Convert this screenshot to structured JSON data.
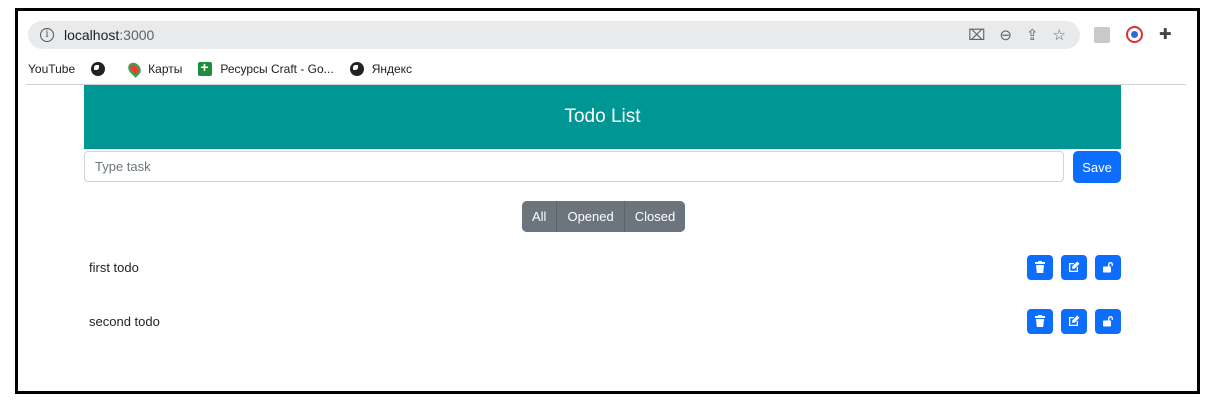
{
  "browser": {
    "url_host": "localhost",
    "url_port": ":3000",
    "bookmarks": [
      {
        "label": "YouTube",
        "icon": "none"
      },
      {
        "label": "",
        "icon": "globe-icon"
      },
      {
        "label": "Карты",
        "icon": "maps-pin-icon"
      },
      {
        "label": "Ресурсы Craft - Go...",
        "icon": "sheets-icon"
      },
      {
        "label": "Яндекс",
        "icon": "globe-icon"
      }
    ],
    "address_icons": [
      "translate-icon",
      "zoom-icon",
      "share-icon",
      "star-icon"
    ],
    "extension_icons": [
      "extension-gray-icon",
      "extension-circle-icon",
      "puzzle-icon"
    ]
  },
  "app": {
    "title": "Todo List",
    "input": {
      "placeholder": "Type task",
      "value": ""
    },
    "save_label": "Save",
    "filters": [
      "All",
      "Opened",
      "Closed"
    ],
    "todos": [
      {
        "text": "first todo",
        "status": "opened"
      },
      {
        "text": "second todo",
        "status": "opened"
      }
    ],
    "action_icons": [
      "trash-icon",
      "edit-icon",
      "unlock-icon"
    ],
    "colors": {
      "header": "#009694",
      "primary": "#0d6efd",
      "secondary": "#6c757d"
    }
  }
}
